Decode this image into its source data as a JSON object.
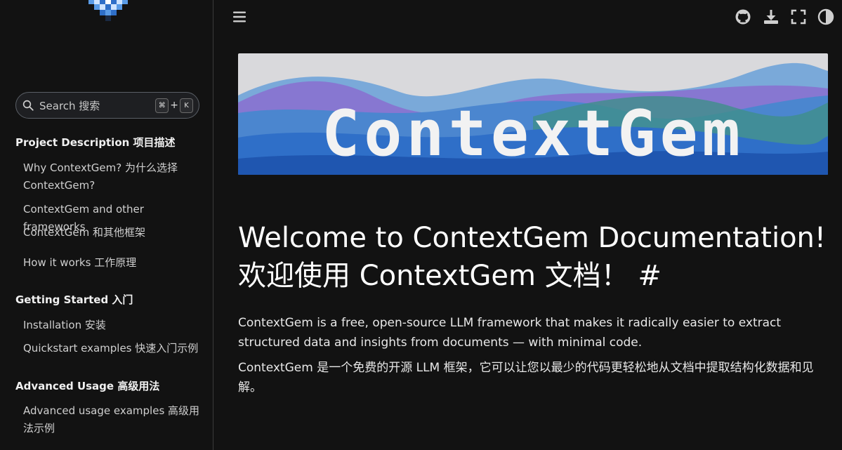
{
  "sidebar": {
    "search": {
      "placeholder": "Search  搜索",
      "key_cmd": "⌘",
      "key_plus": "+",
      "key_k": "K"
    },
    "sections": [
      {
        "caption": "Project Description  项目描述",
        "links": [
          "Why ContextGem?  为什么选择 ContextGem?",
          "ContextGem and other frameworks",
          "ContextGem 和其他框架",
          "How it works  工作原理"
        ]
      },
      {
        "caption": "Getting Started  入门",
        "links": [
          "Installation  安装",
          "Quickstart examples  快速入门示例"
        ]
      },
      {
        "caption": "Advanced Usage  高级用法",
        "links": [
          "Advanced usage examples  高级用法示例"
        ]
      }
    ]
  },
  "header": {
    "icons": [
      "menu-icon",
      "github-icon",
      "download-icon",
      "fullscreen-icon",
      "theme-toggle-icon"
    ]
  },
  "main": {
    "banner_text": "ContextGem",
    "title": "Welcome to ContextGem Documentation! 欢迎使用 ContextGem 文档！",
    "anchor": "#",
    "paragraph_en": "ContextGem is a free, open-source LLM framework that makes it radically easier to extract structured data and insights from documents — with minimal code.",
    "paragraph_zh": "ContextGem 是一个免费的开源 LLM 框架，它可以让您以最少的代码更轻松地从文档中提取结构化数据和见解。"
  },
  "colors": {
    "background": "#121212",
    "sidebar_border": "#3b3b3b",
    "banner_top": "#d9d9dc",
    "banner_blue": "#2f6fc8",
    "banner_purple": "#7a5bc6",
    "banner_teal": "#3f8f8a"
  }
}
